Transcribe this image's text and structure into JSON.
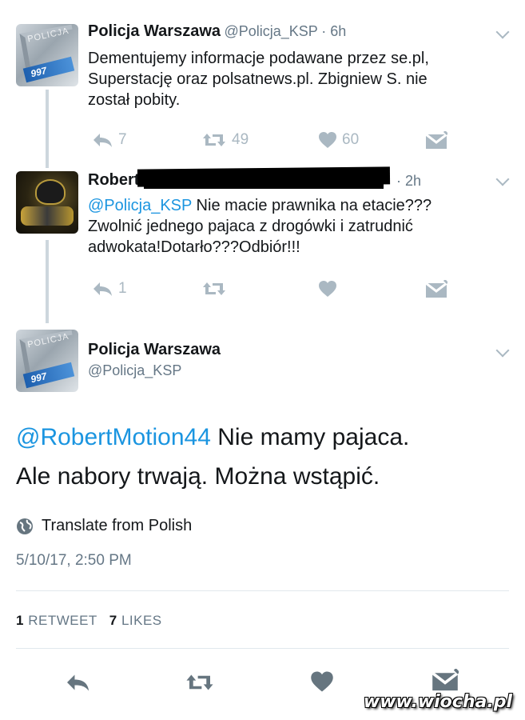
{
  "tweet1": {
    "name": "Policja Warszawa",
    "handle": "@Policja_KSP",
    "time": "· 6h",
    "avatar_text": "POLICJA",
    "avatar_number": "997",
    "lines": [
      "Dementujemy informacje podawane przez se.pl,",
      "Superstację oraz polsatnews.pl. Zbigniew S. nie",
      "został pobity."
    ],
    "reply_count": "7",
    "retweet_count": "49",
    "like_count": "60"
  },
  "tweet2": {
    "name": "Robert",
    "time": "· 2h",
    "mention": "@Policja_KSP",
    "line1_rest": " Nie macie prawnika na etacie???",
    "lines": [
      "Zwolnić jednego pajaca z drogówki i zatrudnić",
      "adwokata!Dotarło???Odbiór!!!"
    ],
    "reply_count": "1"
  },
  "tweet3": {
    "name": "Policja Warszawa",
    "handle": "@Policja_KSP",
    "avatar_text": "POLICJA",
    "avatar_number": "997",
    "mention": "@RobertMotion44",
    "line1_rest": " Nie mamy pajaca.",
    "line2": "Ale nabory trwają. Można wstąpić.",
    "translate": "Translate from Polish",
    "timestamp": "5/10/17, 2:50 PM",
    "retweets_num": "1",
    "retweets_label": "RETWEET",
    "likes_num": "7",
    "likes_label": "LIKES"
  },
  "watermark": "www.wiocha.pl",
  "colors": {
    "accent": "#1b95e0",
    "muted": "#aab8c2",
    "gray_text": "#657786",
    "dark_icon": "#66757f"
  }
}
